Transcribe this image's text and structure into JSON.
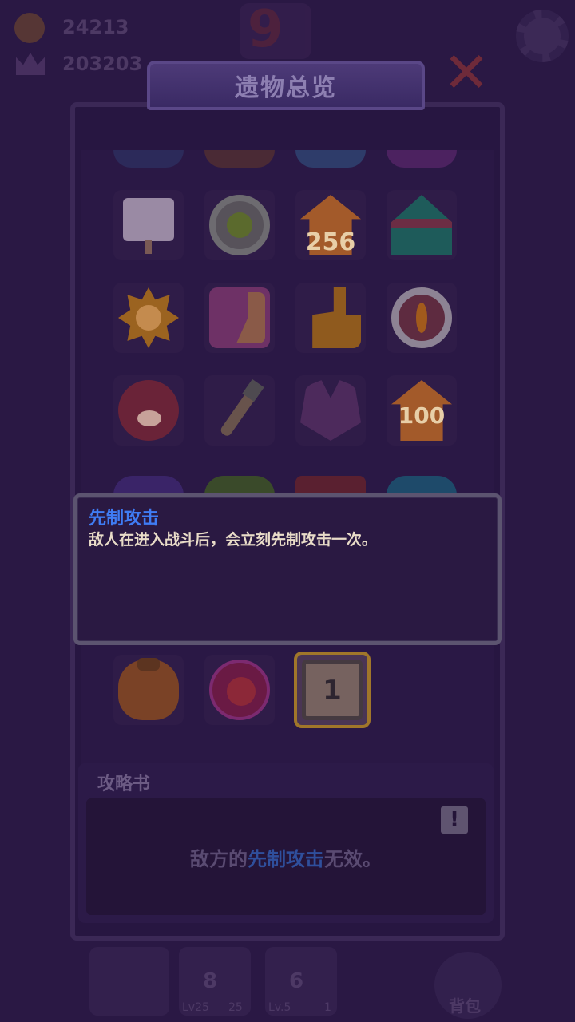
{
  "hud": {
    "coins": "24213",
    "trophies": "203203",
    "level": "9"
  },
  "panel": {
    "title": "遗物总览",
    "close_icon": "close-x-icon"
  },
  "relics": [
    {
      "id": "signboard",
      "icon": "signboard-icon"
    },
    {
      "id": "clover",
      "icon": "clover-coin-icon"
    },
    {
      "id": "house-256",
      "icon": "house-icon",
      "label": "256"
    },
    {
      "id": "tent",
      "icon": "circus-tent-icon"
    },
    {
      "id": "sun",
      "icon": "angry-sun-icon"
    },
    {
      "id": "dice",
      "icon": "yin-yang-dice-icon"
    },
    {
      "id": "thumb",
      "icon": "thumbs-up-icon"
    },
    {
      "id": "ring",
      "icon": "eye-ring-icon"
    },
    {
      "id": "pig",
      "icon": "pig-helmet-icon"
    },
    {
      "id": "arrow",
      "icon": "arrow-icon"
    },
    {
      "id": "armor",
      "icon": "armor-icon"
    },
    {
      "id": "house-100",
      "icon": "house-icon",
      "label": "100"
    },
    {
      "id": "bag",
      "icon": "money-bag-icon"
    },
    {
      "id": "skull",
      "icon": "skull-orb-icon"
    },
    {
      "id": "card",
      "icon": "card-icon",
      "label": "1"
    }
  ],
  "tooltip": {
    "title": "先制攻击",
    "description": "敌人在进入战斗后，会立刻先制攻击一次。"
  },
  "guide": {
    "title": "攻略书",
    "text_prefix": "敌方的",
    "text_highlight": "先制攻击",
    "text_suffix": "无效。",
    "warn_symbol": "!"
  },
  "bottom": {
    "slot1_number": "8",
    "slot1_sub": "Lv25",
    "slot1_sub2": "25",
    "slot2_number": "6",
    "slot2_sub": "Lv.5",
    "slot2_sub2": "1",
    "bag_label": "背包"
  },
  "colors": {
    "tooltip_title": "#3f7cf4",
    "highlight": "#2f4f9c",
    "selected_border": "#a0762a"
  }
}
